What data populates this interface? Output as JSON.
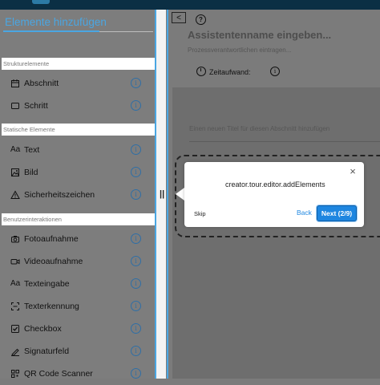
{
  "sidebar": {
    "title": "Elemente hinzufügen",
    "sections": [
      {
        "label": "Strukturelemente"
      },
      {
        "label": "Statische Elemente"
      },
      {
        "label": "Benutzerinteraktionen"
      }
    ],
    "items": [
      {
        "label": "Abschnitt",
        "icon": "calendar-icon"
      },
      {
        "label": "Schritt",
        "icon": "square-icon"
      },
      {
        "label": "Text",
        "icon": "text-aa-icon"
      },
      {
        "label": "Bild",
        "icon": "image-icon"
      },
      {
        "label": "Sicherheitszeichen",
        "icon": "warning-icon"
      },
      {
        "label": "Fotoaufnahme",
        "icon": "camera-icon"
      },
      {
        "label": "Videoaufnahme",
        "icon": "video-icon"
      },
      {
        "label": "Texteingabe",
        "icon": "text-aa-icon"
      },
      {
        "label": "Texterkennung",
        "icon": "scan-icon"
      },
      {
        "label": "Checkbox",
        "icon": "checkbox-icon"
      },
      {
        "label": "Signaturfeld",
        "icon": "signature-icon"
      },
      {
        "label": "QR Code Scanner",
        "icon": "qr-icon"
      }
    ],
    "info_symbol": "i"
  },
  "editor": {
    "collapse_symbol": "<",
    "help_symbol": "?",
    "assistant_name_placeholder": "Assistentenname eingeben...",
    "process_owner_placeholder": "Prozessverantwortlichen eintragen...",
    "time_label": "Zeitaufwand:",
    "section_title_placeholder": "Einen neuen Titel für diesen Abschnitt hinzufügen",
    "splitter_grip": "||"
  },
  "tour": {
    "message": "creator.tour.editor.addElements",
    "skip": "Skip",
    "back": "Back",
    "next": "Next (2/9)",
    "close": "×"
  },
  "colors": {
    "accent": "#4aa6e2",
    "primary_button": "#1e86e0",
    "topbar": "#0b2f44"
  }
}
